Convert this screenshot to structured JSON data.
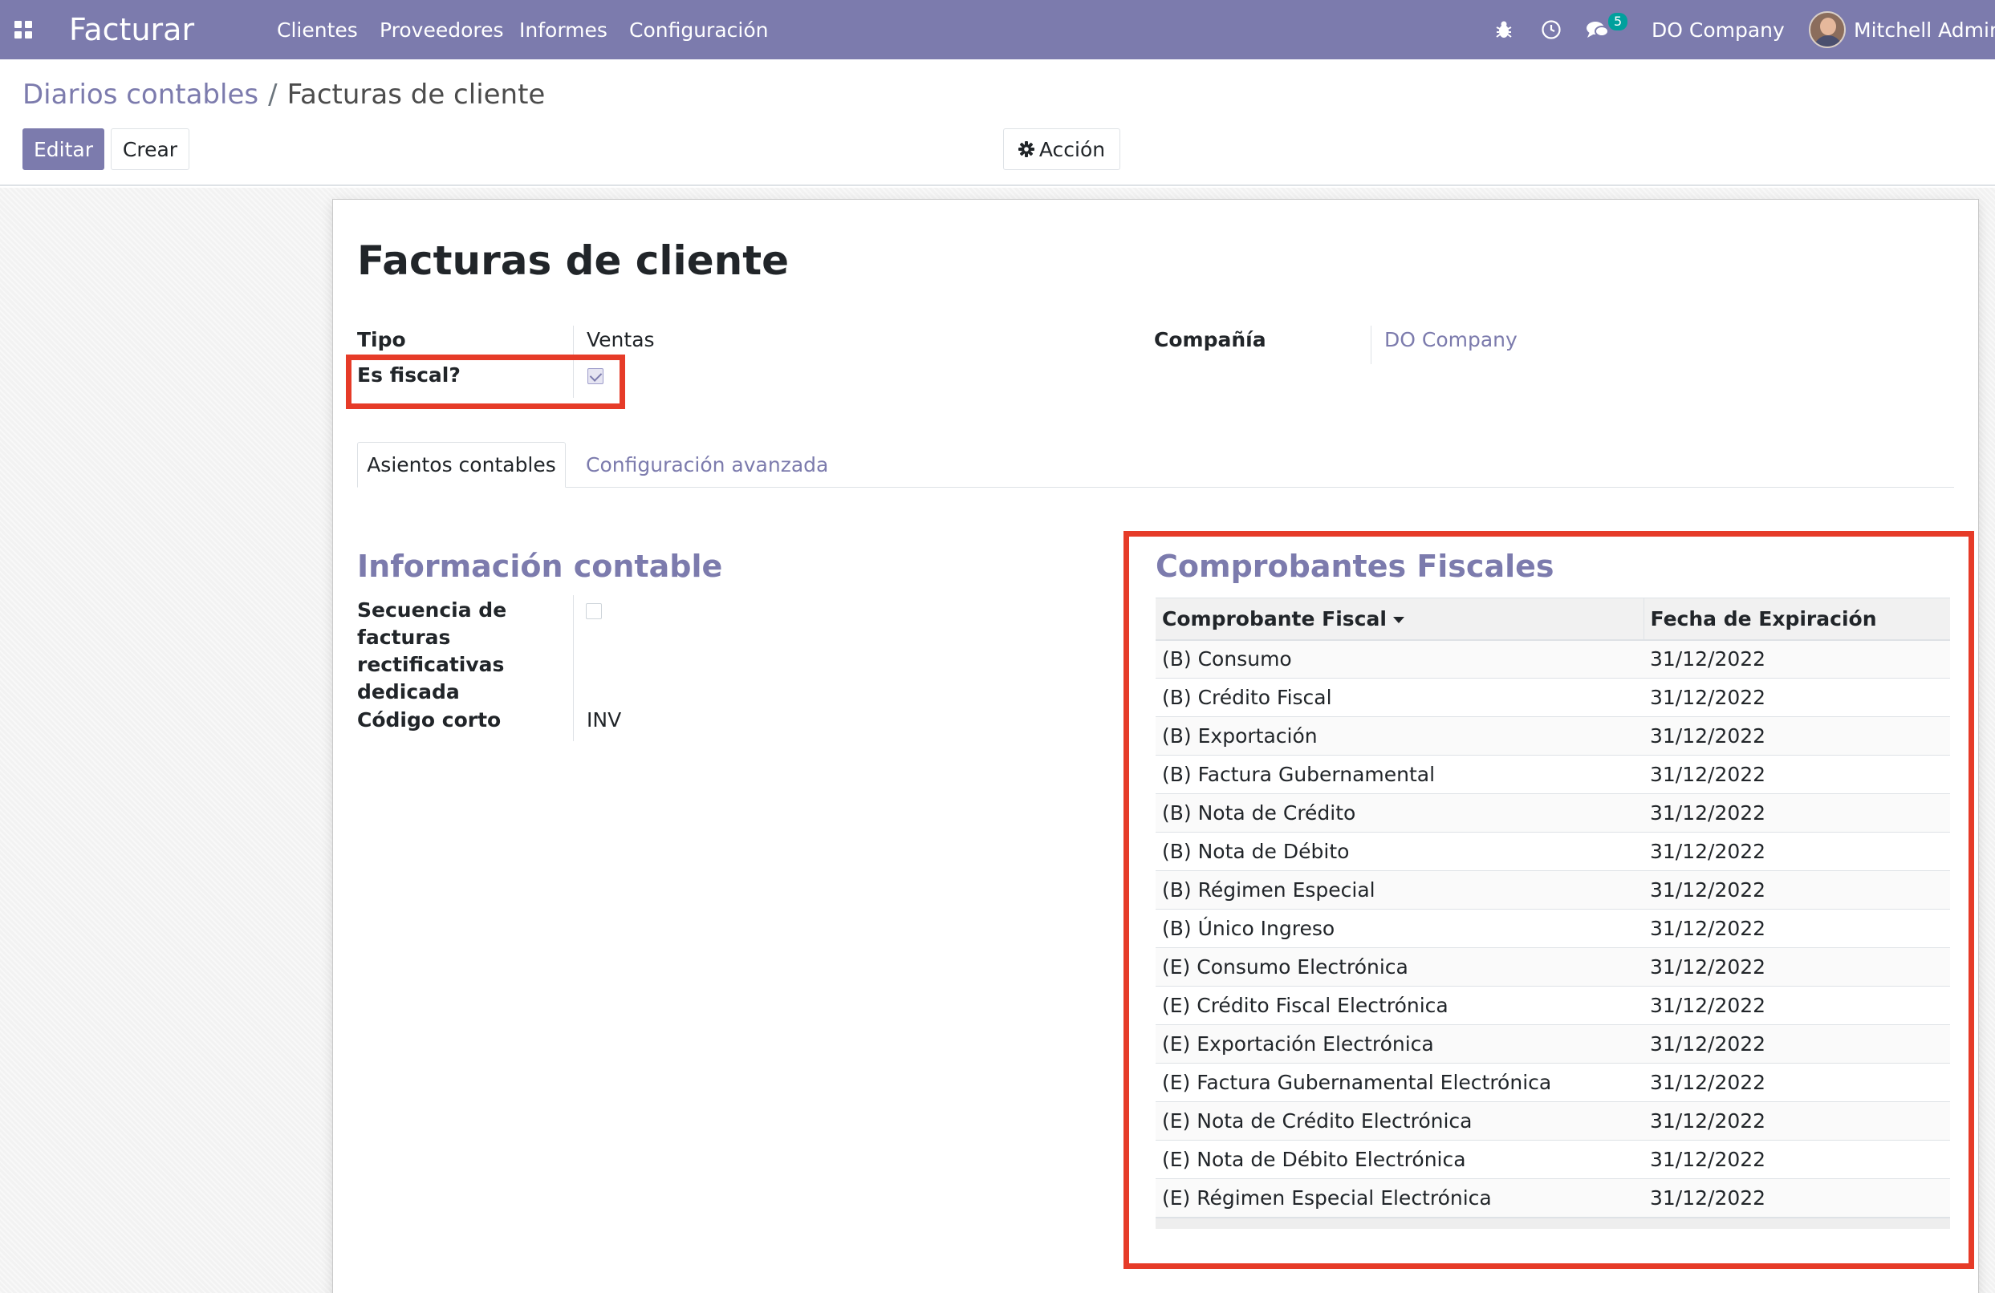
{
  "navbar": {
    "app_name": "Facturar",
    "menu": [
      "Clientes",
      "Proveedores",
      "Informes",
      "Configuración"
    ],
    "chat_count": "5",
    "company": "DO Company",
    "user": "Mitchell Admin",
    "color": "#7c7bad",
    "icons": [
      "apps-icon",
      "bug-icon",
      "clock-icon",
      "chat-icon",
      "avatar"
    ]
  },
  "breadcrumb": {
    "parent": "Diarios contables",
    "separator": "/",
    "current": "Facturas de cliente"
  },
  "buttons": {
    "edit": "Editar",
    "create": "Crear",
    "action": "Acción"
  },
  "form": {
    "title": "Facturas de cliente",
    "tipo_label": "Tipo",
    "tipo_value": "Ventas",
    "fiscal_label": "Es fiscal?",
    "fiscal_checked": true,
    "compania_label": "Compañía",
    "compania_value": "DO Company"
  },
  "tabs": [
    "Asientos contables",
    "Configuración avanzada"
  ],
  "info_contable": {
    "title": "Información contable",
    "secuencia_label": "Secuencia de facturas rectificativas dedicada",
    "secuencia_checked": false,
    "codigo_label": "Código corto",
    "codigo_value": "INV"
  },
  "comprobantes": {
    "title": "Comprobantes Fiscales",
    "columns": [
      "Comprobante Fiscal",
      "Fecha de Expiración"
    ],
    "rows": [
      {
        "name": "(B) Consumo",
        "date": "31/12/2022"
      },
      {
        "name": "(B) Crédito Fiscal",
        "date": "31/12/2022"
      },
      {
        "name": "(B) Exportación",
        "date": "31/12/2022"
      },
      {
        "name": "(B) Factura Gubernamental",
        "date": "31/12/2022"
      },
      {
        "name": "(B) Nota de Crédito",
        "date": "31/12/2022"
      },
      {
        "name": "(B) Nota de Débito",
        "date": "31/12/2022"
      },
      {
        "name": "(B) Régimen Especial",
        "date": "31/12/2022"
      },
      {
        "name": "(B) Único Ingreso",
        "date": "31/12/2022"
      },
      {
        "name": "(E) Consumo Electrónica",
        "date": "31/12/2022"
      },
      {
        "name": "(E) Crédito Fiscal Electrónica",
        "date": "31/12/2022"
      },
      {
        "name": "(E) Exportación Electrónica",
        "date": "31/12/2022"
      },
      {
        "name": "(E) Factura Gubernamental Electrónica",
        "date": "31/12/2022"
      },
      {
        "name": "(E) Nota de Crédito Electrónica",
        "date": "31/12/2022"
      },
      {
        "name": "(E) Nota de Débito Electrónica",
        "date": "31/12/2022"
      },
      {
        "name": "(E) Régimen Especial Electrónica",
        "date": "31/12/2022"
      }
    ]
  },
  "highlight_color": "#e63b28"
}
